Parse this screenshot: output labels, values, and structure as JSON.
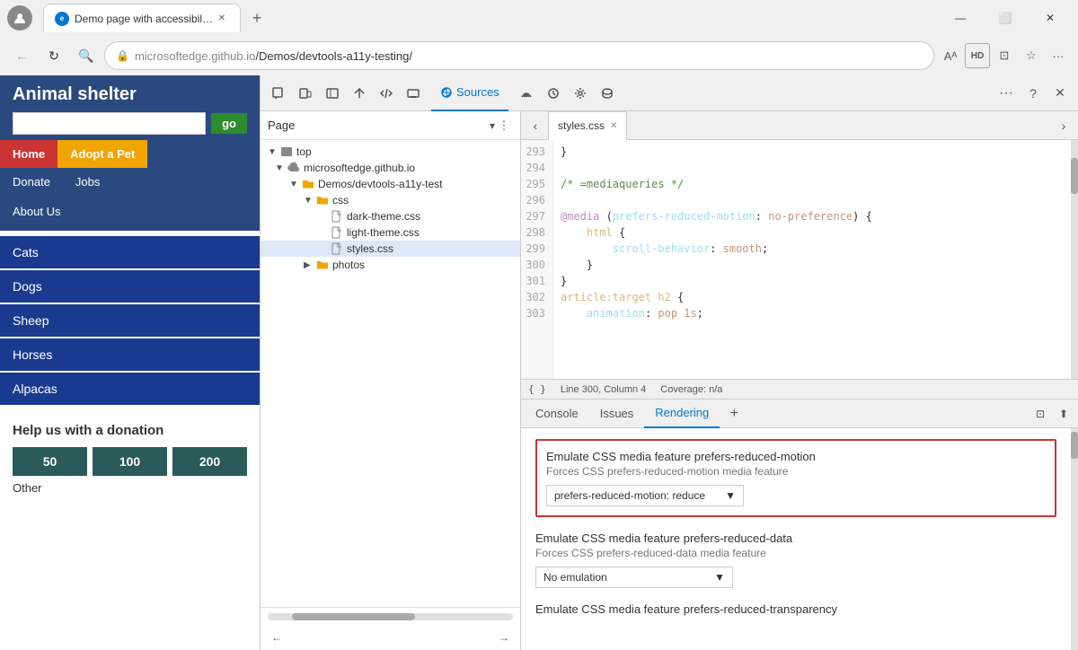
{
  "browser": {
    "tab_title": "Demo page with accessibility iss",
    "address": "microsoftedge.github.io/Demos/devtools-a11y-testing/",
    "address_gray_part": "microsoftedge.github.io",
    "address_path": "/Demos/devtools-a11y-testing/",
    "new_tab_label": "+",
    "window_minimize": "—",
    "window_restore": "⬜",
    "window_close": "✕"
  },
  "website": {
    "title": "Animal shelter",
    "search_placeholder": "",
    "search_btn": "go",
    "nav": {
      "home": "Home",
      "adopt": "Adopt a Pet",
      "donate": "Donate",
      "jobs": "Jobs",
      "about": "About Us"
    },
    "animals": [
      "Cats",
      "Dogs",
      "Sheep",
      "Horses",
      "Alpacas"
    ],
    "donation": {
      "title": "Help us with a donation",
      "amounts": [
        "50",
        "100",
        "200"
      ],
      "other": "Other"
    }
  },
  "devtools": {
    "toolbar_buttons": [
      "inspect",
      "device-emulation",
      "toggle-sidebar",
      "navigate-home",
      "source-code",
      "screencast",
      "sources-tab",
      "network-conditions",
      "performance",
      "settings",
      "memory",
      "more-tools",
      "add"
    ],
    "sources_tab_label": "Sources",
    "page_label": "Page",
    "page_dropdown": "▾",
    "more_options": "⋮",
    "file_tree": {
      "top": "top",
      "domain": "microsoftedge.github.io",
      "path": "Demos/devtools-a11y-test",
      "css_folder": "css",
      "files": [
        "dark-theme.css",
        "light-theme.css",
        "styles.css"
      ],
      "photos_folder": "photos"
    },
    "code_tab": "styles.css",
    "code_lines": {
      "start": 293,
      "lines": [
        {
          "num": "293",
          "content": "}"
        },
        {
          "num": "294",
          "content": ""
        },
        {
          "num": "295",
          "content": "/* =mediaqueries */",
          "type": "comment"
        },
        {
          "num": "296",
          "content": ""
        },
        {
          "num": "297",
          "content": "@media (prefers-reduced-motion: no-preference) {",
          "type": "media"
        },
        {
          "num": "298",
          "content": "    html {",
          "type": "selector"
        },
        {
          "num": "299",
          "content": "        scroll-behavior: smooth;",
          "type": "prop"
        },
        {
          "num": "300",
          "content": "    }",
          "type": "normal"
        },
        {
          "num": "301",
          "content": "}",
          "type": "normal"
        },
        {
          "num": "302",
          "content": "article:target h2 {",
          "type": "selector"
        },
        {
          "num": "303",
          "content": "    animation: pop 1s;",
          "type": "prop"
        }
      ]
    },
    "status_bar": {
      "braces": "{ }",
      "position": "Line 300, Column 4",
      "coverage": "Coverage: n/a"
    },
    "bottom_tabs": [
      "Console",
      "Issues",
      "Rendering"
    ],
    "active_tab": "Rendering",
    "rendering": {
      "section1_label": "Emulate CSS media feature prefers-reduced-motion",
      "section1_sublabel": "Forces CSS prefers-reduced-motion media feature",
      "section1_value": "prefers-reduced-motion: reduce",
      "section2_label": "Emulate CSS media feature prefers-reduced-data",
      "section2_sublabel": "Forces CSS prefers-reduced-data media feature",
      "section2_value": "No emulation",
      "section3_label": "Emulate CSS media feature prefers-reduced-transparency"
    }
  }
}
